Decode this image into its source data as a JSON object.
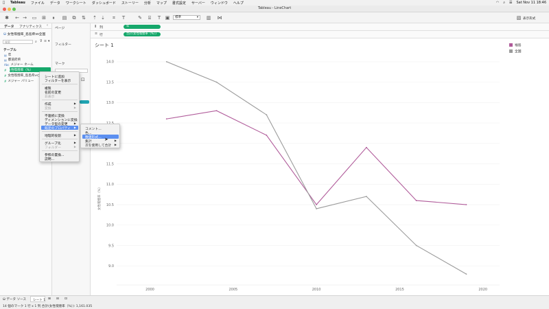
{
  "menubar": {
    "app": "Tableau",
    "items": [
      "ファイル",
      "データ",
      "ワークシート",
      "ダッシュボード",
      "ストーリー",
      "分析",
      "マップ",
      "書式設定",
      "サーバー",
      "ウィンドウ",
      "ヘルプ"
    ],
    "clock": "Sat Nov 11  18:46"
  },
  "window": {
    "title": "Tableau - LineChart"
  },
  "toolbar": {
    "fit_select": "標準",
    "show_me": "表示形式"
  },
  "leftpane": {
    "tab_data": "データ",
    "tab_analytics": "アナリティクス",
    "datasource": "女性喫煙率_島島県vs全国",
    "search_placeholder": "検索",
    "tables_header": "テーブル",
    "fields": [
      "年",
      "都道府県",
      "メジャー ネーム",
      "女性喫煙率（%）",
      "女性喫煙率_島島県vs全国",
      "メジャー バリュー"
    ]
  },
  "shelves": {
    "pages": "ページ",
    "filters": "フィルター",
    "marks": "マーク",
    "columns_label": "列",
    "rows_label": "行",
    "columns_pill": "年",
    "rows_pill": "合計(女性喫煙率（%）)"
  },
  "sheet": {
    "title": "シート 1",
    "yaxis_label": "女性喫煙率（%）"
  },
  "context_menu": {
    "items": [
      "シートに追加",
      "フィルターを表示",
      "複製",
      "名前の変更",
      "非表示",
      "作成",
      "変換",
      "不連続に変換",
      "ディメンションに変換",
      "データ型の変更",
      "既定のプロパティ",
      "地理的役割",
      "グループ化",
      "フォルダー",
      "参照の置換...",
      "説明..."
    ],
    "submenu": [
      "コメント...",
      "色...",
      "数値形式...",
      "集計",
      "次を使用して合計"
    ]
  },
  "legend": [
    "福島",
    "全国"
  ],
  "chart_data": {
    "type": "line",
    "xlim": [
      1998,
      2021
    ],
    "ylim": [
      8.6,
      14.2
    ],
    "xticks": [
      2000,
      2005,
      2010,
      2015,
      2020
    ],
    "yticks": [
      9.0,
      9.5,
      10.0,
      10.5,
      11.0,
      11.5,
      12.0,
      12.5,
      13.0,
      13.5,
      14.0
    ],
    "series": [
      {
        "name": "福島",
        "color": "#b05b9a",
        "x": [
          2001,
          2004,
          2007,
          2010,
          2013,
          2016,
          2019
        ],
        "y": [
          12.6,
          12.8,
          12.2,
          10.5,
          11.9,
          10.6,
          10.5
        ]
      },
      {
        "name": "全国",
        "color": "#9b9b9b",
        "x": [
          2001,
          2004,
          2007,
          2010,
          2013,
          2016,
          2019
        ],
        "y": [
          14.0,
          13.5,
          12.7,
          10.4,
          10.7,
          9.5,
          8.8
        ]
      }
    ]
  },
  "statusbar": {
    "tab_source": "データ ソース",
    "tab_sheet": "シート 1",
    "info": "14 個のマーク    1 行 x 1 列    合計(女性喫煙率（%）): 1,161.035"
  }
}
